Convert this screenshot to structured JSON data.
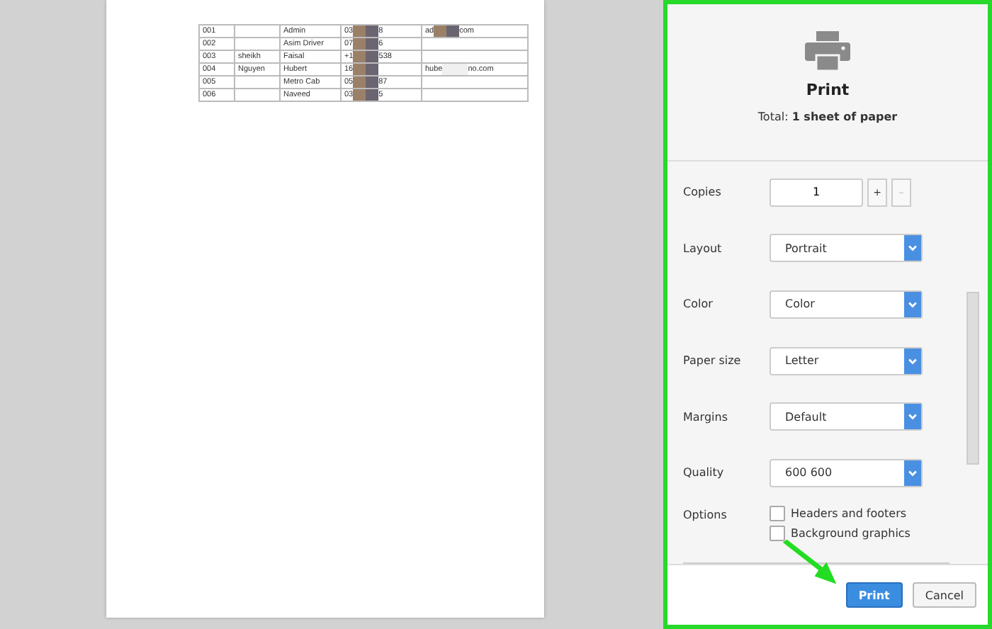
{
  "preview": {
    "table": {
      "rows": [
        {
          "cells": [
            {
              "kind": "text",
              "text": "001"
            },
            {
              "kind": "empty"
            },
            {
              "kind": "text",
              "text": "Admin"
            },
            {
              "kind": "redacted",
              "before": "03",
              "after": "8"
            },
            {
              "kind": "redacted",
              "before": "ad",
              "after": "com"
            }
          ]
        },
        {
          "cells": [
            {
              "kind": "text",
              "text": "002"
            },
            {
              "kind": "empty"
            },
            {
              "kind": "text",
              "text": "Asim Driver"
            },
            {
              "kind": "redacted",
              "before": "07",
              "after": "6"
            },
            {
              "kind": "empty"
            }
          ]
        },
        {
          "cells": [
            {
              "kind": "text",
              "text": "003"
            },
            {
              "kind": "text",
              "text": "sheikh"
            },
            {
              "kind": "text",
              "text": "Faisal"
            },
            {
              "kind": "redacted",
              "before": "+1",
              "after": "538"
            },
            {
              "kind": "empty"
            }
          ]
        },
        {
          "cells": [
            {
              "kind": "text",
              "text": "004"
            },
            {
              "kind": "text",
              "text": "Nguyen"
            },
            {
              "kind": "text",
              "text": "Hubert"
            },
            {
              "kind": "redacted",
              "before": "16"
            },
            {
              "kind": "redacted",
              "before": "hube",
              "after": "no.com"
            }
          ]
        },
        {
          "cells": [
            {
              "kind": "text",
              "text": "005"
            },
            {
              "kind": "empty"
            },
            {
              "kind": "text",
              "text": "Metro Cab"
            },
            {
              "kind": "redacted",
              "before": "05",
              "after": "87"
            },
            {
              "kind": "empty"
            }
          ]
        },
        {
          "cells": [
            {
              "kind": "text",
              "text": "006"
            },
            {
              "kind": "empty"
            },
            {
              "kind": "text",
              "text": "Naveed"
            },
            {
              "kind": "redacted",
              "before": "03",
              "after": "5"
            },
            {
              "kind": "empty"
            }
          ]
        }
      ]
    }
  },
  "panel": {
    "title": "Print",
    "total_label": "Total:",
    "total_value": "1 sheet of paper",
    "settings": [
      {
        "kind": "number",
        "label": "Copies",
        "value": "1",
        "increment": "+",
        "decrement": "–"
      },
      {
        "kind": "select",
        "label": "Layout",
        "value": "Portrait"
      },
      {
        "kind": "select",
        "label": "Color",
        "value": "Color"
      },
      {
        "kind": "select",
        "label": "Paper size",
        "value": "Letter"
      },
      {
        "kind": "select",
        "label": "Margins",
        "value": "Default"
      },
      {
        "kind": "select",
        "label": "Quality",
        "value": "600 600"
      },
      {
        "kind": "checkboxes",
        "label": "Options",
        "options": [
          {
            "label": "Headers and footers",
            "checked": false
          },
          {
            "label": "Background graphics",
            "checked": false
          }
        ]
      }
    ],
    "buttons": [
      {
        "label": "Print",
        "primary": true
      },
      {
        "label": "Cancel",
        "primary": false
      }
    ]
  }
}
